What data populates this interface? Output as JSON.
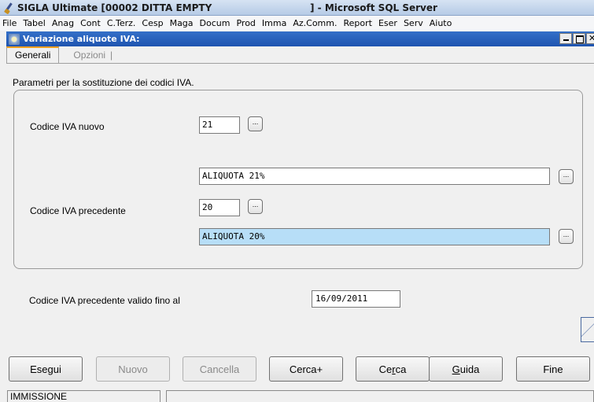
{
  "window": {
    "title": "SIGLA Ultimate [00002 DITTA EMPTY",
    "title_suffix": "] - Microsoft SQL Server"
  },
  "menu": [
    "File",
    "Tabel",
    "Anag",
    "Cont",
    "C.Terz.",
    "Cesp",
    "Maga",
    "Docum",
    "Prod",
    "Imma",
    "Az.Comm.",
    "Report",
    "Eser",
    "Serv",
    "Aiuto"
  ],
  "form": {
    "title": "Variazione aliquote IVA:",
    "tabs": [
      "Generali",
      "Opzioni"
    ],
    "tab_separator": "|",
    "section_label": "Parametri per la sostituzione dei codici IVA.",
    "new_code": {
      "label": "Codice IVA nuovo",
      "value": "21",
      "description": "ALIQUOTA 21%"
    },
    "prev_code": {
      "label": "Codice IVA precedente",
      "value": "20",
      "description": "ALIQUOTA 20%"
    },
    "valid_until": {
      "label": "Codice IVA precedente valido fino al",
      "value": "16/09/2011"
    },
    "lookup_button": "..."
  },
  "buttons": {
    "esegui": "Esegui",
    "nuovo": "Nuovo",
    "cancella": "Cancella",
    "cerca_plus": "Cerca+",
    "cerca_a": "Ce",
    "cerca_u": "r",
    "cerca_b": "ca",
    "guida_u": "G",
    "guida_b": "uida",
    "fine": "Fine"
  },
  "status": {
    "mode": "IMMISSIONE"
  },
  "colors": {
    "highlight_field": "#b7def7",
    "active_tab_accent": "#f0a020",
    "inner_title_bg": "#1e54b0"
  }
}
